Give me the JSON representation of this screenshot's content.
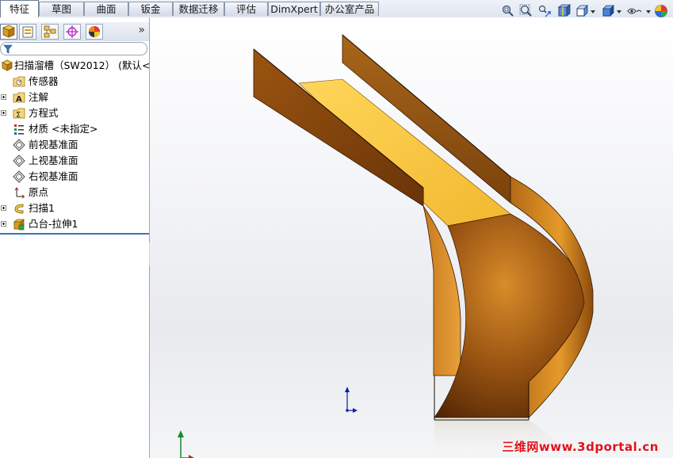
{
  "command_tabs": [
    "特征",
    "草图",
    "曲面",
    "钣金",
    "数据迁移",
    "评估",
    "DimXpert",
    "办公室产品"
  ],
  "active_tab": "特征",
  "heads_up_toolbar": [
    "zoom-to-fit-icon",
    "zoom-to-area-icon",
    "previous-view-icon",
    "section-view-icon",
    "view-orientation-icon",
    "display-style-icon",
    "hide-show-items-icon",
    "appearance-icon"
  ],
  "manager_tabs": [
    "feature-manager-icon",
    "property-manager-icon",
    "configuration-manager-icon",
    "dimxpert-manager-icon",
    "display-manager-icon"
  ],
  "collapse_glyph": "»",
  "feature_tree": {
    "root": "扫描溜槽（SW2012） (默认<<",
    "items": [
      {
        "label": "传感器",
        "icon": "sensor-folder-icon",
        "expandable": false
      },
      {
        "label": "注解",
        "icon": "annotations-folder-icon",
        "expandable": true
      },
      {
        "label": "方程式",
        "icon": "equations-folder-icon",
        "expandable": true
      },
      {
        "label": "材质 <未指定>",
        "icon": "material-icon",
        "expandable": false
      },
      {
        "label": "前视基准面",
        "icon": "plane-icon",
        "expandable": false
      },
      {
        "label": "上视基准面",
        "icon": "plane-icon",
        "expandable": false
      },
      {
        "label": "右视基准面",
        "icon": "plane-icon",
        "expandable": false
      },
      {
        "label": "原点",
        "icon": "origin-icon",
        "expandable": false
      },
      {
        "label": "扫描1",
        "icon": "sweep-feature-icon",
        "expandable": true
      },
      {
        "label": "凸台-拉伸1",
        "icon": "extrude-feature-icon",
        "expandable": true
      }
    ]
  },
  "watermark": "三维网www.3dportal.cn",
  "colors": {
    "part_light": "#f5c040",
    "part_mid": "#c97d1a",
    "part_dark": "#5a2c06",
    "tree_divider": "#3b73b9",
    "triad_blue": "#0a1fa8"
  }
}
